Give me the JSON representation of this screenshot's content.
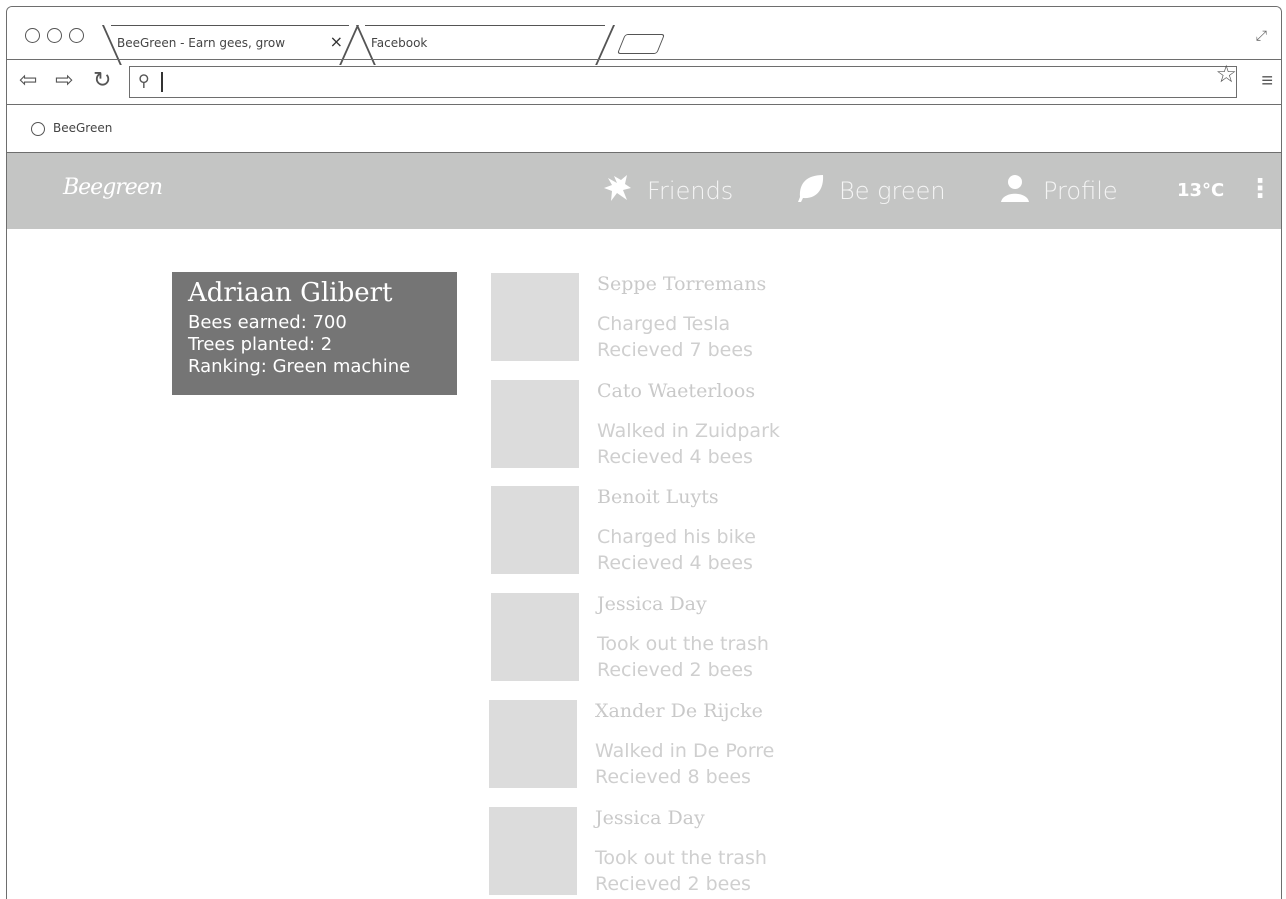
{
  "browser": {
    "tabs": [
      {
        "label": "BeeGreen - Earn gees, grow",
        "close": "×"
      },
      {
        "label": "Facebook"
      }
    ],
    "address": {
      "value": ""
    },
    "bookmark": {
      "label": "BeeGreen"
    }
  },
  "app": {
    "logo": "Beegreen",
    "nav": [
      {
        "label": "Friends",
        "icon": "bee-icon"
      },
      {
        "label": "Be green",
        "icon": "leaf-icon"
      },
      {
        "label": "Profile",
        "icon": "user-icon"
      }
    ],
    "temperature": "13°C"
  },
  "profile": {
    "name": "Adriaan Glibert",
    "bees": "Bees earned: 700",
    "trees": "Trees planted: 2",
    "ranking": "Ranking: Green machine"
  },
  "feed": [
    {
      "name": "Seppe Torremans",
      "action": "Charged Tesla",
      "reward": "Recieved 7 bees"
    },
    {
      "name": "Cato Waeterloos",
      "action": "Walked in Zuidpark",
      "reward": "Recieved 4 bees"
    },
    {
      "name": "Benoit Luyts",
      "action": "Charged his bike",
      "reward": "Recieved 4 bees"
    },
    {
      "name": "Jessica Day",
      "action": "Took out the trash",
      "reward": "Recieved 2 bees"
    },
    {
      "name": "Xander De Rijcke",
      "action": "Walked in De Porre",
      "reward": "Recieved 8 bees"
    },
    {
      "name": "Jessica Day",
      "action": "Took out the trash",
      "reward": "Recieved 2 bees"
    }
  ]
}
